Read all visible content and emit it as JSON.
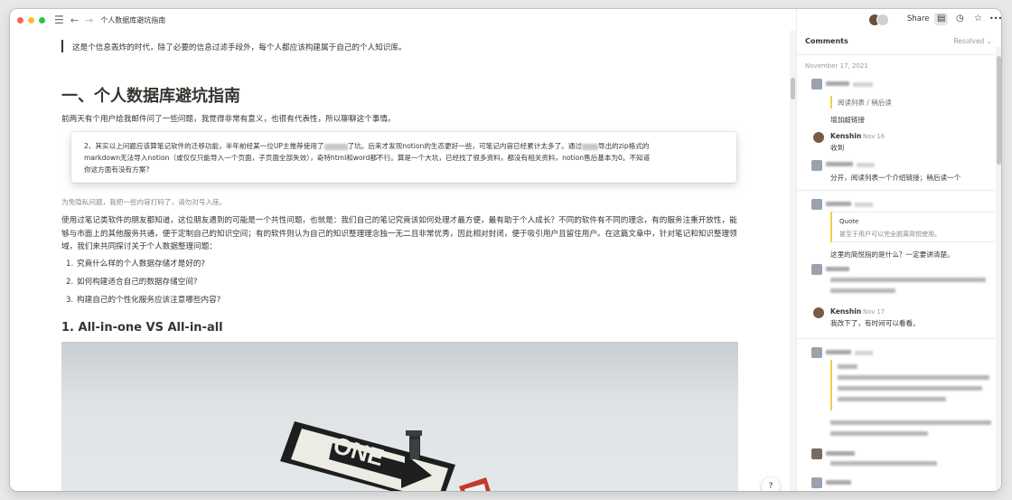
{
  "window": {
    "title": "个人数据库避坑指南"
  },
  "toolbar": {
    "menu_icon": "☰",
    "back_icon": "←",
    "forward_icon": "→",
    "share_label": "Share",
    "comments_icon": "▤",
    "history_icon": "◷",
    "favorite_icon": "☆",
    "more_icon": "•••"
  },
  "doc": {
    "intro": "这是个信息轰炸的时代，除了必要的信息过滤手段外，每个人都应该构建属于自己的个人知识库。",
    "heading1": "一、个人数据库避坑指南",
    "p1": "前两天有个用户给我邮件问了一些问题，我觉得非常有意义，也很有代表性，所以聊聊这个事情。",
    "card": {
      "line1_a": "2、其实以上问题应该算笔记软件的迁移功能，半年前经某一位UP主推荐使用了",
      "line1_b": "了坑。后来才发现notion的生态更好一些，可笔记内容已经累计太多了。通过",
      "line1_c": "导出的zip格式的",
      "line2": "markdown无法导入notion（或仅仅只能导入一个页面，子页面全部失效），奇特html和word都不行。算是一个大坑，已经找了很多资料，都没有相关资料，notion售后基本为0。不知道",
      "line3": "你这方面有没有方案?"
    },
    "note": "为免隐私问题，我把一些内容打码了，请勿对号入座。",
    "para": "使用过笔记类软件的朋友都知道，这位朋友遇到的可能是一个共性问题，也就是：我们自己的笔记究竟该如何处理才最方便，最有助于个人成长？不同的软件有不同的理念，有的服务注重开放性，能够与市面上的其他服务共通，便于定制自己的知识空间；有的软件则认为自己的知识整理理念独一无二且非常优秀，因此相对封闭，便于吸引用户且留住用户。在这篇文章中，针对笔记和知识整理领域，我们来共同探讨关于个人数据整理问题：",
    "list": [
      {
        "num": "1.",
        "text": "究竟什么样的个人数据存储才是好的?"
      },
      {
        "num": "2.",
        "text": "如何构建适合自己的数据存储空间?"
      },
      {
        "num": "3.",
        "text": "构建自己的个性化服务应该注意哪些内容?"
      }
    ],
    "heading2": "1. All-in-one VS All-in-all",
    "sign_text": "ONE",
    "help_label": "?"
  },
  "panel": {
    "header": "Comments",
    "resolved": "Resolved ⌄",
    "date": "November 17, 2021",
    "thread1": {
      "highlight": "阅读列表 / 稍后读",
      "comment1": "增加超链接",
      "reply_name": "Kenshin",
      "reply_time": "Nov 16",
      "reply_text": "收到",
      "comment3": "分开，阅读列表一个介绍链接；稍后读一个"
    },
    "thread2": {
      "quote_label": "Quote",
      "quote_text": "甚至于用户可以完全脱离简悦使用。",
      "comment1": "这里的简悦指的是什么？一定要讲清楚。",
      "reply_name": "Kenshin",
      "reply_time": "Nov 17",
      "reply_text": "我改下了，有时间可以看看。"
    }
  },
  "colors": {
    "accent_highlight": "#f2cd4b",
    "text": "#37352f",
    "muted": "#9b9a97"
  }
}
